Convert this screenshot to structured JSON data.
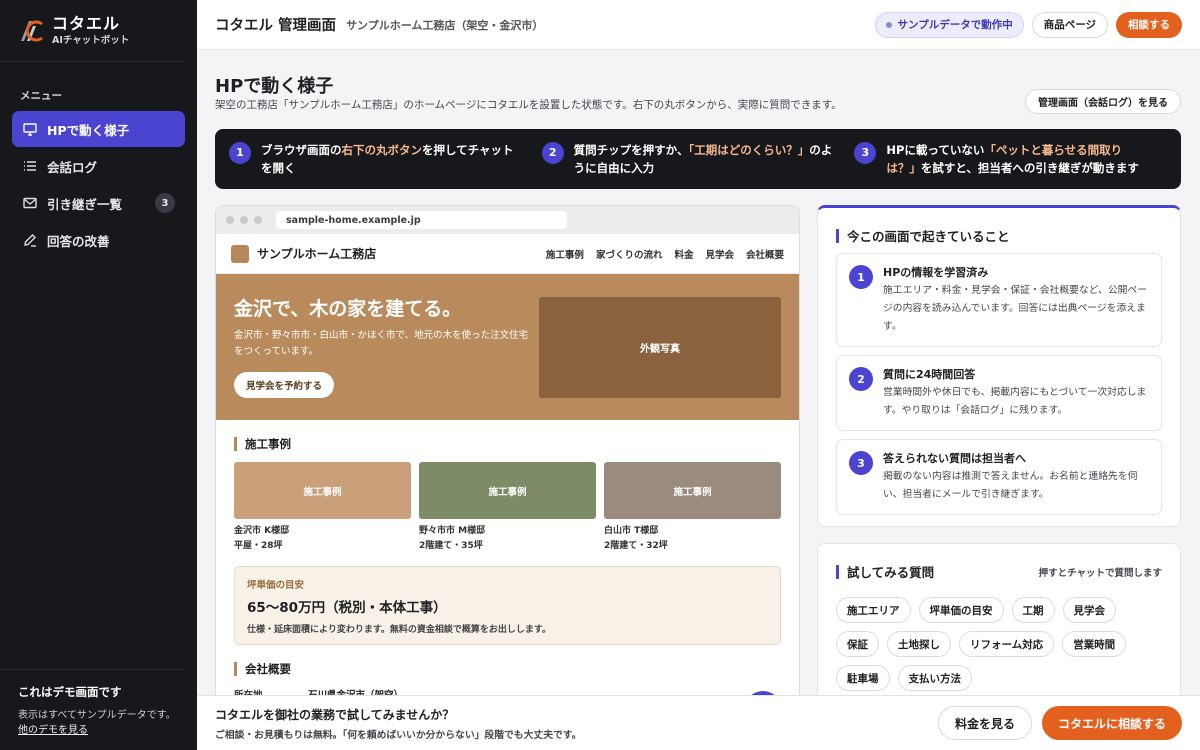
{
  "app": {
    "name": "コタエル",
    "subtitle": "AIチャットボット"
  },
  "sidebar": {
    "menu_label": "メニュー",
    "items": [
      {
        "label": "HPで動く様子",
        "icon": "monitor-icon",
        "active": true
      },
      {
        "label": "会話ログ",
        "icon": "list-icon"
      },
      {
        "label": "引き継ぎ一覧",
        "icon": "mail-icon",
        "count": "3"
      },
      {
        "label": "回答の改善",
        "icon": "pencil-icon"
      }
    ],
    "footer": {
      "title": "これはデモ画面です",
      "text": "表示はすべてサンプルデータです。",
      "link": "他のデモを見る"
    }
  },
  "topbar": {
    "title": "コタエル 管理画面",
    "subtitle": "サンプルホーム工務店（架空・金沢市）",
    "status": "サンプルデータで動作中",
    "product_button": "商品ページ",
    "consult_button": "相談する"
  },
  "page": {
    "title": "HPで動く様子",
    "description": "架空の工務店「サンプルホーム工務店」のホームページにコタエルを設置した状態です。右下の丸ボタンから、実際に質問できます。",
    "log_button": "管理画面（会話ログ）を見る"
  },
  "steps": [
    {
      "num": "1",
      "pre": "ブラウザ画面の",
      "hl": "右下の丸ボタン",
      "post": "を押してチャットを開く"
    },
    {
      "num": "2",
      "pre": "質問チップを押すか、",
      "hl": "「工期はどのくらい？」",
      "post": "のように自由に入力"
    },
    {
      "num": "3",
      "pre": "HPに載っていない",
      "hl": "「ペットと暮らせる間取りは？」",
      "post": "を試すと、担当者への引き継ぎが動きます"
    }
  ],
  "browser": {
    "url": "sample-home.example.jp",
    "site_name": "サンプルホーム工務店",
    "nav": [
      "施工事例",
      "家づくりの流れ",
      "料金",
      "見学会",
      "会社概要"
    ],
    "hero": {
      "title": "金沢で、木の家を建てる。",
      "text": "金沢市・野々市市・白山市・かほく市で、地元の木を使った注文住宅をつくっています。",
      "button": "見学会を予約する",
      "photo_label": "外観写真"
    },
    "cases_title": "施工事例",
    "cases": [
      {
        "image_label": "施工事例",
        "color": "#c9a07a",
        "line1": "金沢市 K様邸",
        "line2": "平屋・28坪"
      },
      {
        "image_label": "施工事例",
        "color": "#7d8c66",
        "line1": "野々市市 M様邸",
        "line2": "2階建て・35坪"
      },
      {
        "image_label": "施工事例",
        "color": "#9a8b7e",
        "line1": "白山市 T様邸",
        "line2": "2階建て・32坪"
      }
    ],
    "price": {
      "label": "坪単価の目安",
      "value": "65〜80万円（税別・本体工事）",
      "note": "仕様・延床面積により変わります。無料の資金相談で概算をお出しします。"
    },
    "company_title": "会社概要",
    "company_key": "所在地",
    "company_value": "石川県金沢市（架空）"
  },
  "panel_now": {
    "title": "今この画面で起きていること",
    "cards": [
      {
        "num": "1",
        "title": "HPの情報を学習済み",
        "text": "施工エリア・料金・見学会・保証・会社概要など、公開ページの内容を読み込んでいます。回答には出典ページを添えます。"
      },
      {
        "num": "2",
        "title": "質問に24時間回答",
        "text": "営業時間外や休日でも、掲載内容にもとづいて一次対応します。やり取りは「会話ログ」に残ります。"
      },
      {
        "num": "3",
        "title": "答えられない質問は担当者へ",
        "text": "掲載のない内容は推測で答えません。お名前と連絡先を伺い、担当者にメールで引き継ぎます。"
      }
    ]
  },
  "panel_try": {
    "title": "試してみる質問",
    "hint": "押すとチャットで質問します",
    "chips": [
      "施工エリア",
      "坪単価の目安",
      "工期",
      "見学会",
      "保証",
      "土地探し",
      "リフォーム対応",
      "営業時間",
      "駐車場",
      "支払い方法"
    ]
  },
  "bottombar": {
    "title": "コタエルを御社の業務で試してみませんか？",
    "text": "ご相談・お見積もりは無料。「何を頼めばいいか分からない」段階でも大丈夫です。",
    "price_button": "料金を見る",
    "consult_button": "コタエルに相談する"
  },
  "colors": {
    "accent": "#4a44d1",
    "brand_orange": "#e4601f",
    "sidebar_bg": "#17181c",
    "wood": "#b98a5c"
  }
}
